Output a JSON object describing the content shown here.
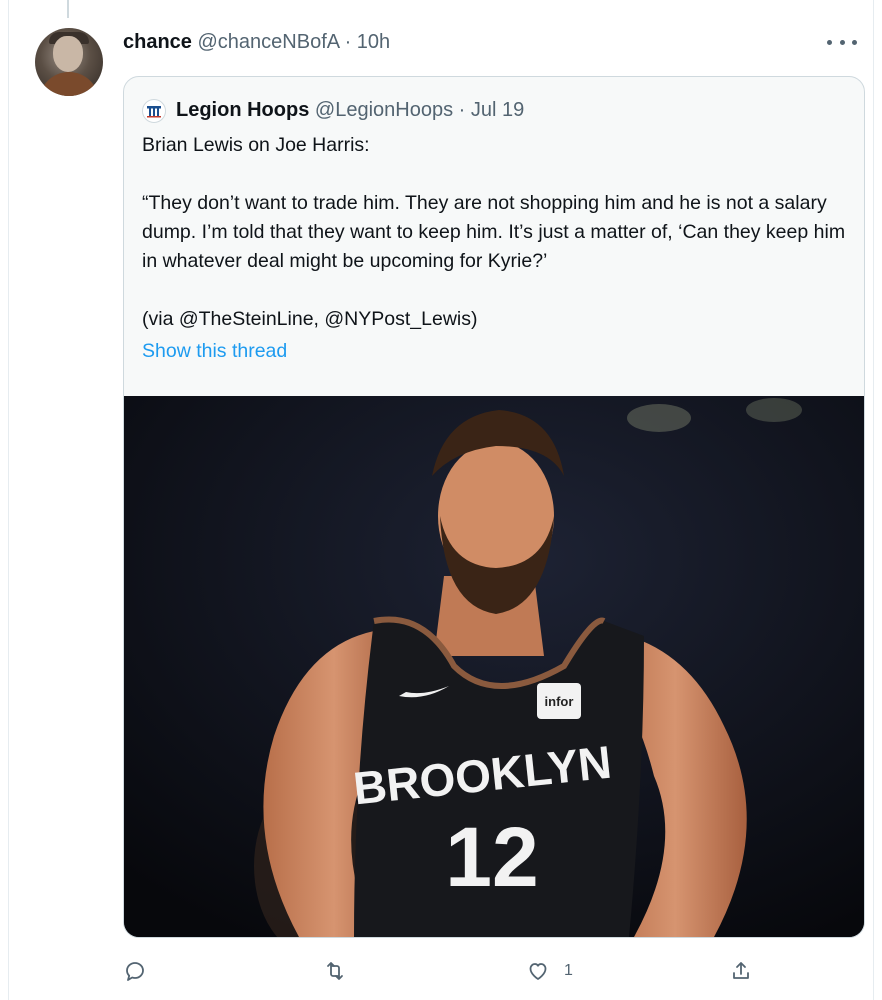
{
  "tweet": {
    "author_name": "chance",
    "author_handle": "@chanceNBofA",
    "separator": "·",
    "time": "10h"
  },
  "quoted": {
    "author_name": "Legion Hoops",
    "author_handle": "@LegionHoops",
    "separator": "·",
    "date": "Jul 19",
    "paragraphs": [
      "Brian Lewis on Joe Harris:",
      "“They don’t want to trade him. They are not shopping him and he is not a salary dump. I’m told that they want to keep him. It’s just a matter of, ‘Can they keep him in whatever deal might be upcoming for Kyrie?’",
      "(via @TheSteinLine, @NYPost_Lewis)"
    ],
    "show_thread": "Show this thread",
    "photo": {
      "jersey_word": "BROOKLYN",
      "jersey_number": "12",
      "sponsor_patch": "infor"
    }
  },
  "actions": {
    "reply_count": "",
    "retweet_count": "",
    "like_count": "1",
    "share_count": ""
  },
  "colors": {
    "link": "#1d9bf0",
    "secondary_text": "#536471",
    "border": "#cfd9de"
  },
  "icons": {
    "reply": "reply-icon",
    "retweet": "retweet-icon",
    "like": "heart-icon",
    "share": "share-icon",
    "more": "more-icon"
  }
}
